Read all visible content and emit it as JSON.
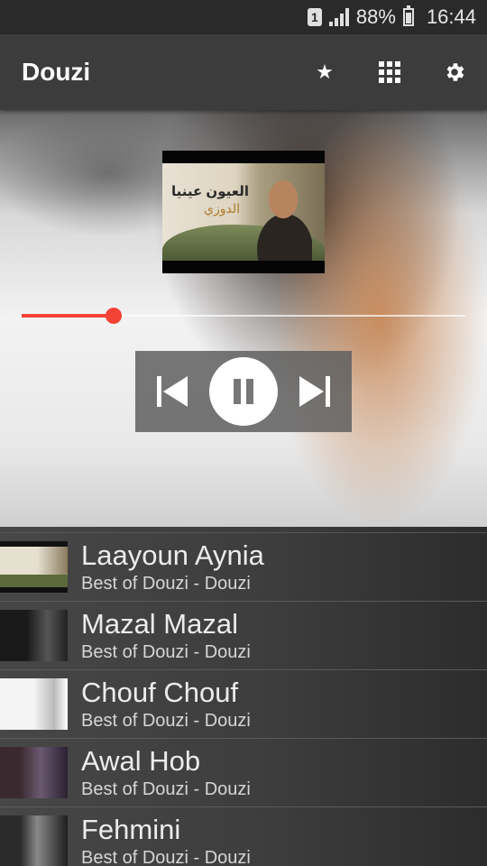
{
  "status_bar": {
    "sim_label": "1",
    "battery": "88%",
    "time": "16:44"
  },
  "app_bar": {
    "title": "Douzi",
    "star_glyph": "★",
    "icons": [
      "star-icon",
      "grid-icon",
      "settings-gear-icon"
    ]
  },
  "player": {
    "now_playing_art": {
      "title_ar": "العيون عينيا",
      "artist_ar": "الدوزي"
    },
    "progress_fraction": 0.207,
    "controls": [
      "skip-previous-icon",
      "pause-icon",
      "skip-next-icon"
    ],
    "accent_color": "#f44336"
  },
  "playlist": [
    {
      "title": "Laayoun Aynia",
      "subtitle": "Best of Douzi - Douzi"
    },
    {
      "title": "Mazal Mazal",
      "subtitle": "Best of Douzi - Douzi"
    },
    {
      "title": "Chouf Chouf",
      "subtitle": "Best of Douzi - Douzi"
    },
    {
      "title": "Awal Hob",
      "subtitle": "Best of Douzi - Douzi"
    },
    {
      "title": "Fehmini",
      "subtitle": "Best of Douzi - Douzi"
    }
  ]
}
